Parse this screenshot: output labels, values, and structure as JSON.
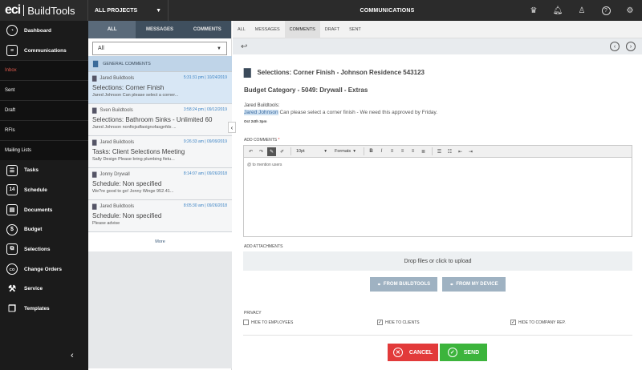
{
  "app": {
    "logo_eci": "eci",
    "logo_product": "BuildTools"
  },
  "topbar": {
    "project_selector": "ALL PROJECTS",
    "title": "COMMUNICATIONS",
    "icons": [
      "award-icon",
      "bell-icon",
      "user-icon",
      "help-icon",
      "gear-icon"
    ]
  },
  "sidebar": {
    "items": [
      {
        "label": "Dashboard",
        "icon": "dashboard-icon"
      },
      {
        "label": "Communications",
        "icon": "chat-icon"
      },
      {
        "label": "Inbox",
        "sub": true,
        "active": true
      },
      {
        "label": "Sent",
        "sub": true
      },
      {
        "label": "Draft",
        "sub": true
      },
      {
        "label": "RFIs",
        "sub": true
      },
      {
        "label": "Mailing Lists",
        "sub": true
      },
      {
        "label": "Tasks",
        "icon": "tasks-icon"
      },
      {
        "label": "Schedule",
        "icon": "calendar-icon",
        "glyph": "14"
      },
      {
        "label": "Documents",
        "icon": "documents-icon"
      },
      {
        "label": "Budget",
        "icon": "dollar-icon",
        "glyph": "$"
      },
      {
        "label": "Selections",
        "icon": "selections-icon"
      },
      {
        "label": "Change Orders",
        "icon": "change-orders-icon",
        "glyph": "CO"
      },
      {
        "label": "Service",
        "icon": "wrench-icon"
      },
      {
        "label": "Templates",
        "icon": "templates-icon"
      }
    ]
  },
  "middle": {
    "tabs": [
      "ALL",
      "MESSAGES",
      "COMMENTS"
    ],
    "filter_value": "All",
    "group_header": "GENERAL COMMENTS",
    "messages": [
      {
        "sender": "Jared Buildtools",
        "date": "5:31:31 pm | 10/24/2019",
        "subject": "Selections: Corner Finish",
        "preview": "Jared Johnson Can please select a corner..."
      },
      {
        "sender": "Sven Buildtools",
        "date": "3:58:24 pm | 09/12/2019",
        "subject": "Selections: Bathroom Sinks - Unlimited 60",
        "preview": "Jared Johnson nonfiojsdfaoignofasgnfds ..."
      },
      {
        "sender": "Jared Buildtools",
        "date": "9:26:33 am | 09/09/2019",
        "subject": "Tasks: Client Selections Meeting",
        "preview": "Sally Design Please bring plumbing fixtu..."
      },
      {
        "sender": "Jonny Drywall",
        "date": "8:14:07 am | 09/26/2018",
        "subject": "Schedule: Non specified",
        "preview": "We?re good to go! Jonny Winge 952.41..."
      },
      {
        "sender": "Jared Buildtools",
        "date": "8:05:30 am | 09/26/2018",
        "subject": "Schedule: Non specified",
        "preview": "Please advise"
      }
    ],
    "more_label": "More"
  },
  "right": {
    "tabs": [
      "ALL",
      "MESSAGES",
      "COMMENTS",
      "DRAFT",
      "SENT"
    ],
    "subject": "Selections: Corner Finish - Johnson Residence 543123",
    "budget_category": "Budget Category - 5049: Drywall - Extras",
    "author": "Jared Buildtools:",
    "mention": "Jared Johnson",
    "body": " Can please select a corner finish - We need this approved by Friday.",
    "date": "Oct 24th 3pm",
    "add_comments_label": "ADD COMMENTS",
    "required_mark": "*",
    "toolbar": {
      "font_size": "10pt",
      "formats": "Formats"
    },
    "editor_placeholder": "@ to mention users",
    "attachments_label": "ADD ATTACHMENTS",
    "dropzone": "Drop files or click to upload",
    "from_buildtools": "FROM BUILDTOOLS",
    "from_device": "FROM MY DEVICE",
    "privacy_label": "PRIVACY",
    "privacy": [
      {
        "label": "HIDE TO EMPLOYEES",
        "checked": false
      },
      {
        "label": "HIDE TO CLIENTS",
        "checked": true
      },
      {
        "label": "HIDE TO COMPANY REP.",
        "checked": true
      }
    ],
    "cancel": "CANCEL",
    "send": "SEND"
  }
}
